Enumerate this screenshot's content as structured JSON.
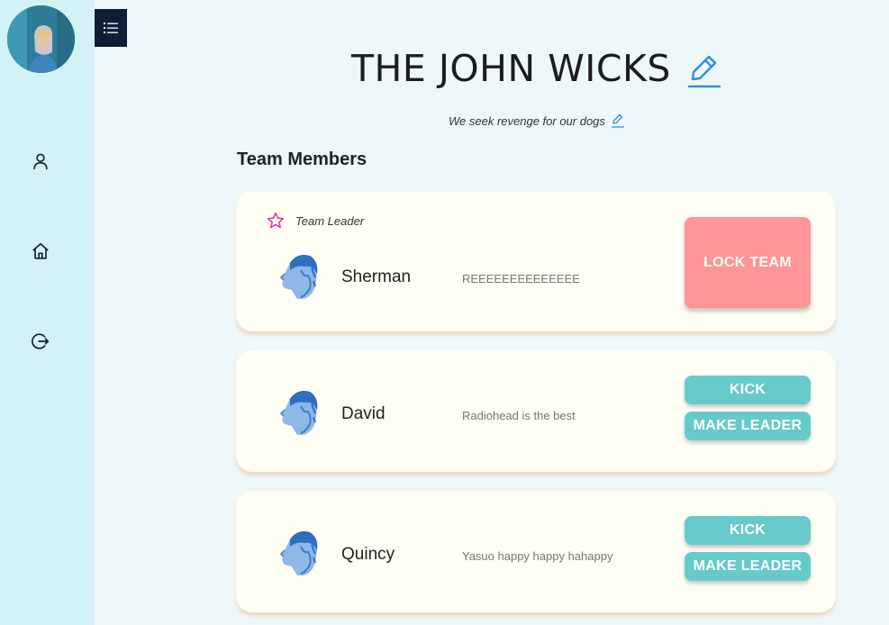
{
  "team": {
    "name": "THE JOHN WICKS",
    "motto": "We seek revenge for our dogs"
  },
  "section_title": "Team Members",
  "leader_label": "Team Leader",
  "members": [
    {
      "name": "Sherman",
      "status": "REEEEEEEEEEEEEE",
      "is_leader": true,
      "action": "LOCK TEAM"
    },
    {
      "name": "David",
      "status": "Radiohead is the best",
      "is_leader": false,
      "kick": "KICK",
      "make_leader": "MAKE LEADER"
    },
    {
      "name": "Quincy",
      "status": "Yasuo happy happy hahappy",
      "is_leader": false,
      "kick": "KICK",
      "make_leader": "MAKE LEADER"
    }
  ],
  "sidebar": {
    "icons": [
      "user-icon",
      "home-icon",
      "logout-icon"
    ]
  },
  "colors": {
    "sidebar_bg": "#d3f2f5",
    "page_bg": "#eef8fa",
    "card_bg": "#fffef4",
    "lock_button": "#ff9596",
    "action_button": "#66cacb",
    "edit_icon": "#2a8fe0",
    "star": "#e0329a",
    "menu_toggle": "#0e1e36"
  }
}
